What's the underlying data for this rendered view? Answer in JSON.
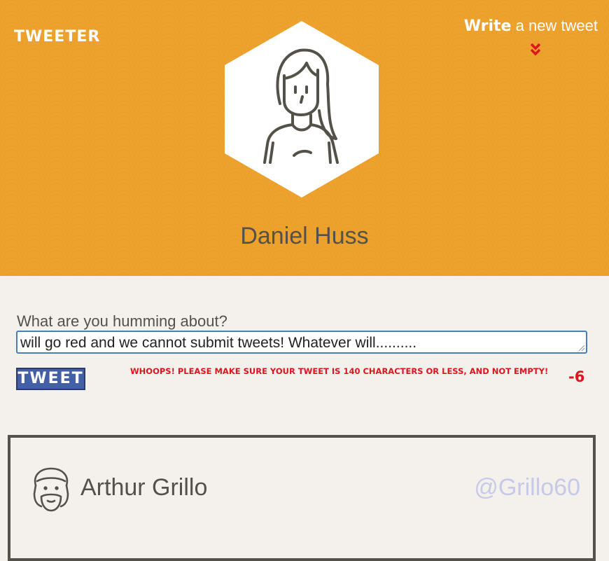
{
  "header": {
    "brand": "TWEETER",
    "write_link_bold": "Write",
    "write_link_rest": " a new tweet",
    "profile_name": "Daniel Huss",
    "colors": {
      "background": "#eea22e",
      "accent": "#e0141e"
    }
  },
  "composer": {
    "label": "What are you humming about?",
    "value": "will go red and we cannot submit tweets! Whatever will..........",
    "button_label": "TWEET",
    "error_message": "WHOOPS! PLEASE MAKE SURE YOUR TWEET IS 140 CHARACTERS OR LESS, AND NOT EMPTY!",
    "char_count": "-6"
  },
  "tweet": {
    "author": "Arthur Grillo",
    "handle": "@Grillo60"
  },
  "icons": {
    "profile_avatar": "woman-avatar-icon",
    "chevron": "double-chevron-down-icon",
    "tweet_avatar": "bearded-man-avatar-icon"
  }
}
